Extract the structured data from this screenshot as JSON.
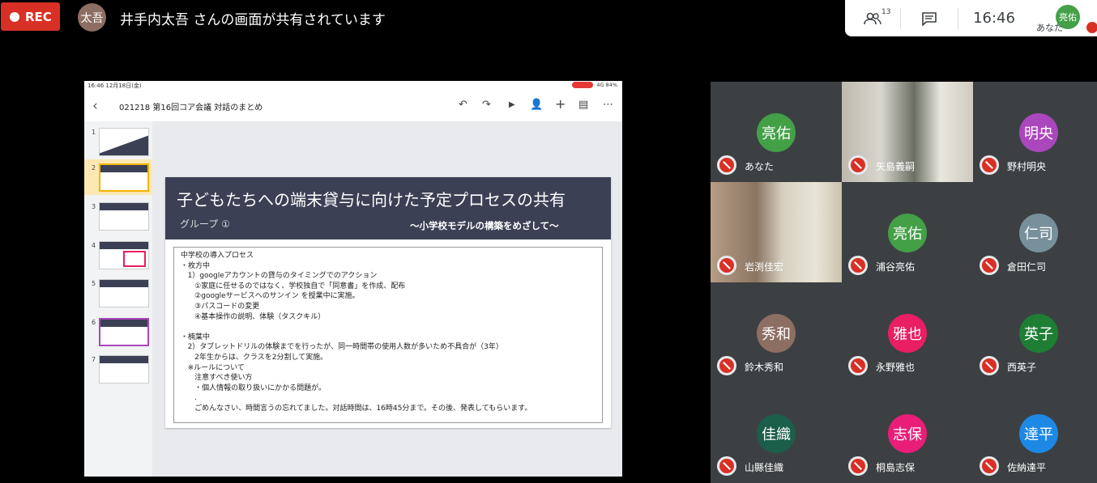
{
  "topbar": {
    "rec_label": "REC",
    "presenter_initials": "太吾",
    "share_message": "井手内太吾 さんの画面が共有されています",
    "people_count": "13",
    "time": "16:46",
    "self_initials": "亮佑",
    "self_label": "あなた",
    "icons": [
      "people-icon",
      "chat-icon",
      "mic-off-icon"
    ]
  },
  "screen": {
    "status_left": "16:46  12月18日(金)",
    "status_right": "4G  84%",
    "doc_title": "021218   第16回コア会議   対話のまとめ",
    "thumb_numbers": [
      "1",
      "2",
      "3",
      "4",
      "5",
      "6",
      "7"
    ],
    "slide": {
      "title": "子どもたちへの端末貸与に向けた予定プロセスの共有",
      "group": "グループ   ①",
      "subtitle": "～小学校モデルの構築をめざして～",
      "lines": [
        "中学校の導入プロセス",
        "・枚方中",
        "   1）googleアカウントの貸与のタイミングでのアクション",
        "      ①家庭に任せるのではなく、学校独自で「同意書」を作成、配布",
        "      ②googleサービスへのサンイン を授業中に実施。",
        "      ③パスコードの変更",
        "      ④基本操作の説明、体験（タスクキル）",
        "",
        "・楠葉中",
        "   2）タブレットドリルの体験までを行ったが、同一時間帯の使用人数が多いため不具合が（3年）",
        "      2年生からは、クラスを2分割して実施。",
        "   ※ルールについて",
        "      注意すべき使い方",
        "      ・個人情報の取り扱いにかかる問題が。",
        "      .",
        "      ごめんなさい、時間言うの忘れてました。対話時間は、16時45分まで。その後、発表してもらいます。"
      ]
    }
  },
  "participants": [
    {
      "initials": "亮佑",
      "name": "あなた",
      "color": "#43a047",
      "video": false
    },
    {
      "initials": "",
      "name": "矢島義嗣",
      "color": "",
      "video": true
    },
    {
      "initials": "明央",
      "name": "野村明央",
      "color": "#ab47bc",
      "video": false
    },
    {
      "initials": "",
      "name": "岩渕佳宏",
      "color": "",
      "video": true
    },
    {
      "initials": "亮佑",
      "name": "浦谷亮佑",
      "color": "#43a047",
      "video": false
    },
    {
      "initials": "仁司",
      "name": "倉田仁司",
      "color": "#78909c",
      "video": false
    },
    {
      "initials": "秀和",
      "name": "鈴木秀和",
      "color": "#8d6e63",
      "video": false
    },
    {
      "initials": "雅也",
      "name": "永野雅也",
      "color": "#e91e63",
      "video": false
    },
    {
      "initials": "英子",
      "name": "西英子",
      "color": "#1e7e34",
      "video": false
    },
    {
      "initials": "佳織",
      "name": "山縣佳織",
      "color": "#1b5e4a",
      "video": false
    },
    {
      "initials": "志保",
      "name": "桐島志保",
      "color": "#e91e78",
      "video": false
    },
    {
      "initials": "達平",
      "name": "佐納達平",
      "color": "#1e88e5",
      "video": false
    }
  ]
}
